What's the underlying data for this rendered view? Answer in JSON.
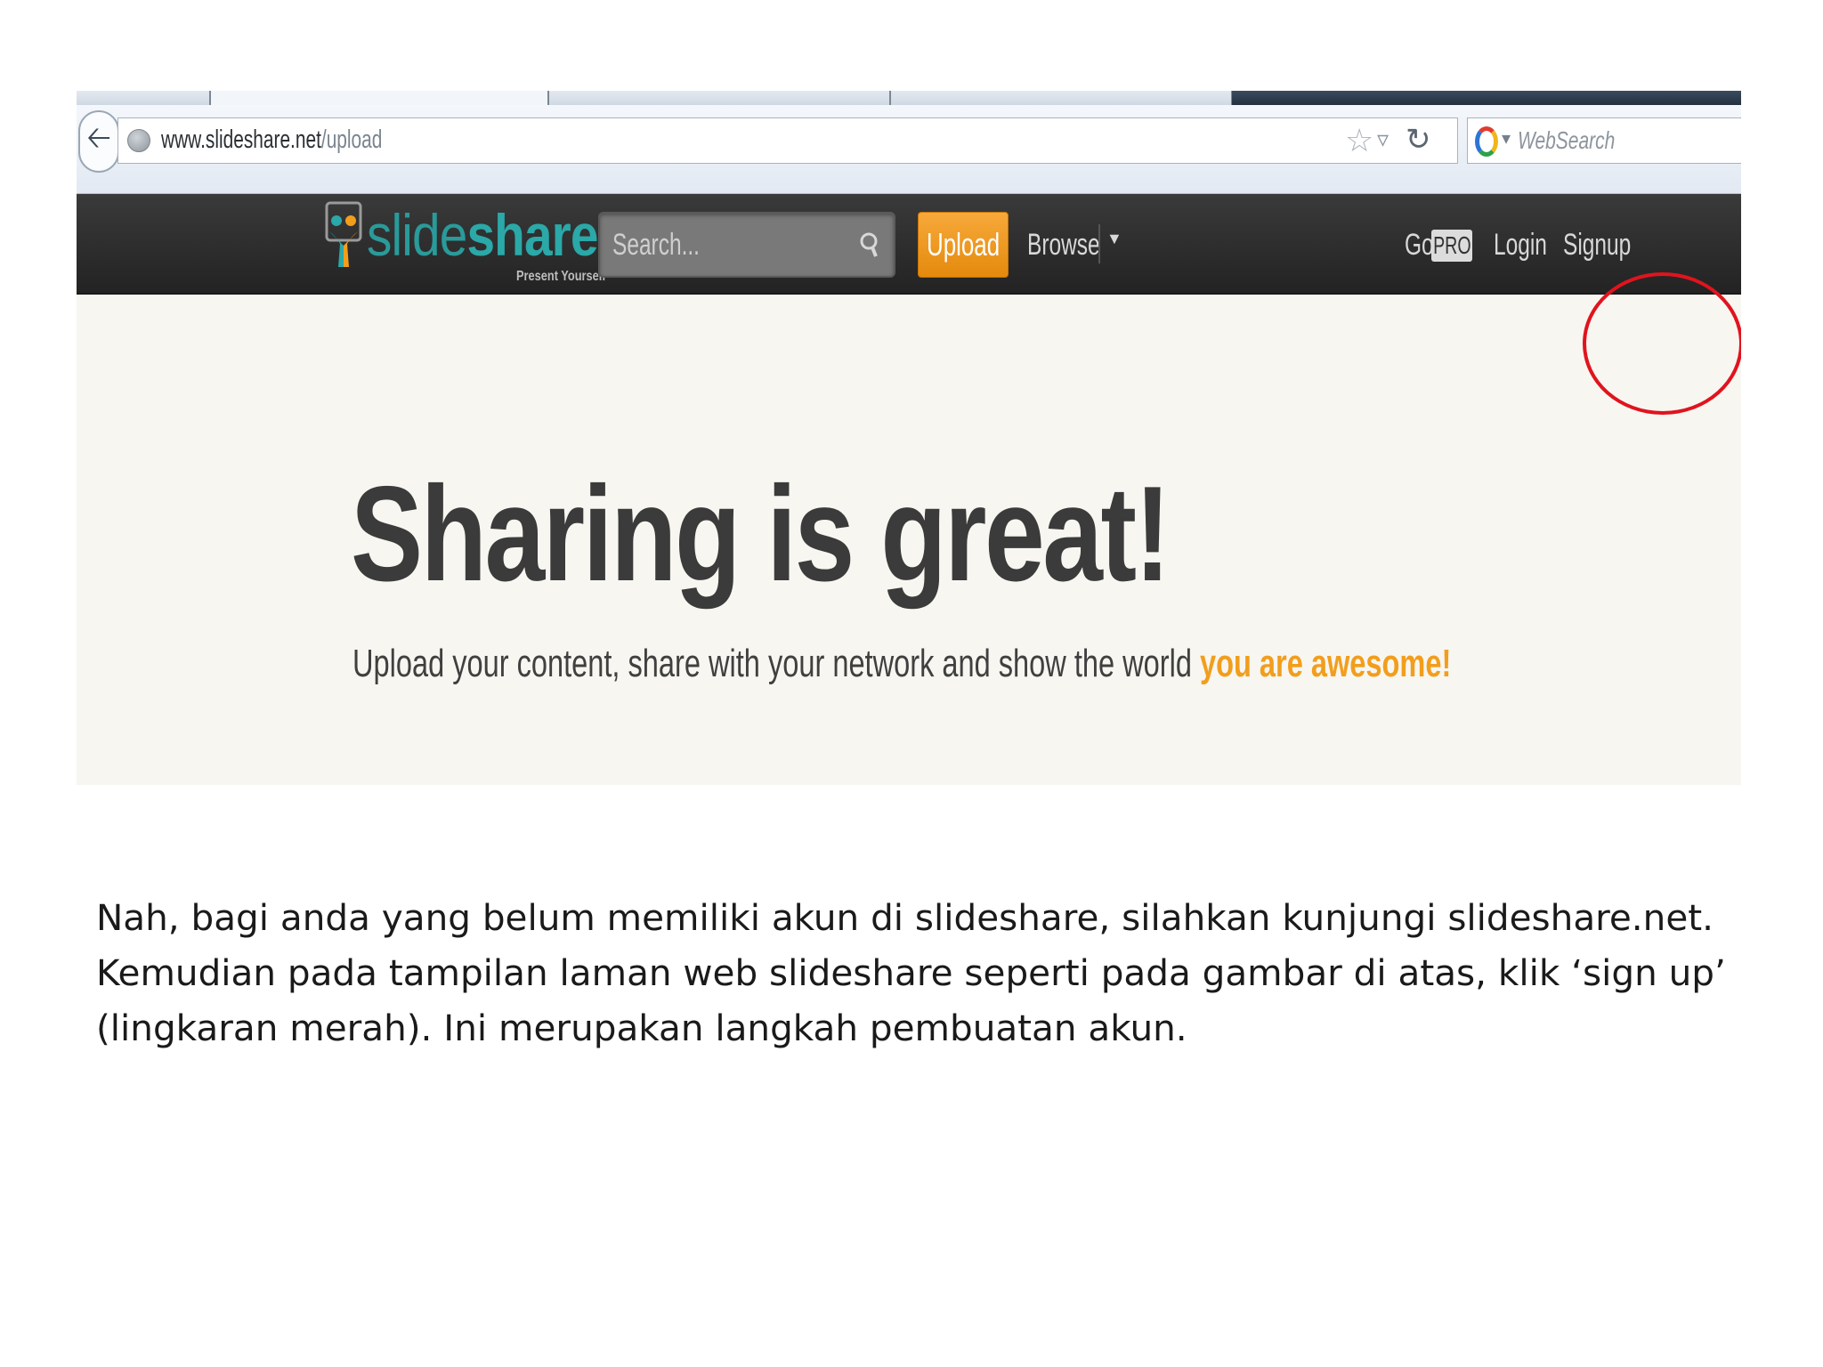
{
  "browser": {
    "url_host": "www.slideshare.net",
    "url_path": "/upload",
    "search_placeholder": "WebSearch"
  },
  "site": {
    "logo_text_light": "slide",
    "logo_text_bold": "share",
    "tagline": "Present Yourself",
    "search_placeholder": "Search...",
    "nav": {
      "upload": "Upload",
      "browse": "Browse",
      "go": "Go",
      "pro": "PRO",
      "login": "Login",
      "signup": "Signup"
    },
    "hero": {
      "title": "Sharing is great!",
      "subtitle": "Upload your content, share with your network and show the world ",
      "subtitle_accent": "you are awesome!"
    }
  },
  "annotation": {
    "circle_color": "#e0141e",
    "circle_target": "Signup"
  },
  "caption": "Nah, bagi anda yang belum memiliki akun di slideshare, silahkan kunjungi slideshare.net. Kemudian pada tampilan laman web slideshare seperti pada gambar di atas, klik ‘sign up’ (lingkaran merah). Ini merupakan langkah pembuatan akun.",
  "colors": {
    "header_bg": "#2b2b2b",
    "upload_orange": "#f29e1c",
    "logo_teal": "#2ba8a8",
    "hero_bg": "#f7f6f1"
  }
}
